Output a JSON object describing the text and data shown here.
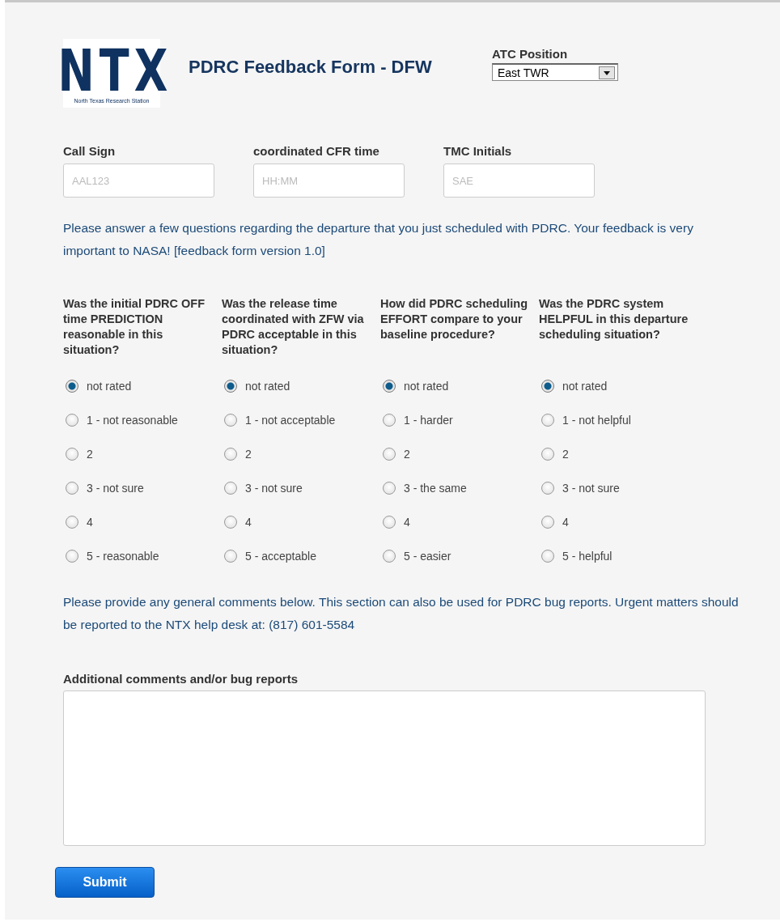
{
  "logo": {
    "letters": "NTX",
    "caption": "North Texas Research Station"
  },
  "title": "PDRC Feedback Form - DFW",
  "atc_position": {
    "label": "ATC Position",
    "value": "East TWR"
  },
  "fields": [
    {
      "label": "Call Sign",
      "placeholder": "AAL123"
    },
    {
      "label": "coordinated CFR time",
      "placeholder": "HH:MM"
    },
    {
      "label": "TMC Initials",
      "placeholder": "SAE"
    }
  ],
  "intro": "Please answer a few questions regarding the departure that you just scheduled with PDRC. Your feedback is very important to NASA! [feedback form version 1.0]",
  "questions": [
    {
      "text": "Was the initial PDRC OFF time PREDICTION reasonable in this situation?",
      "options": [
        {
          "label": "not rated",
          "selected": true
        },
        {
          "label": "1 - not reasonable",
          "selected": false
        },
        {
          "label": "2",
          "selected": false
        },
        {
          "label": "3 - not sure",
          "selected": false
        },
        {
          "label": "4",
          "selected": false
        },
        {
          "label": "5 - reasonable",
          "selected": false
        }
      ]
    },
    {
      "text": "Was the release time coordinated with ZFW via PDRC acceptable in this situation?",
      "options": [
        {
          "label": "not rated",
          "selected": true
        },
        {
          "label": "1 - not acceptable",
          "selected": false
        },
        {
          "label": "2",
          "selected": false
        },
        {
          "label": "3 - not sure",
          "selected": false
        },
        {
          "label": "4",
          "selected": false
        },
        {
          "label": "5 - acceptable",
          "selected": false
        }
      ]
    },
    {
      "text": "How did PDRC scheduling EFFORT compare to your baseline procedure?",
      "options": [
        {
          "label": "not rated",
          "selected": true
        },
        {
          "label": "1 - harder",
          "selected": false
        },
        {
          "label": "2",
          "selected": false
        },
        {
          "label": "3 - the same",
          "selected": false
        },
        {
          "label": "4",
          "selected": false
        },
        {
          "label": "5 - easier",
          "selected": false
        }
      ]
    },
    {
      "text": "Was the PDRC system HELPFUL in this departure scheduling situation?",
      "options": [
        {
          "label": "not rated",
          "selected": true
        },
        {
          "label": "1 - not helpful",
          "selected": false
        },
        {
          "label": "2",
          "selected": false
        },
        {
          "label": "3 - not sure",
          "selected": false
        },
        {
          "label": "4",
          "selected": false
        },
        {
          "label": "5 - helpful",
          "selected": false
        }
      ]
    }
  ],
  "comments_note": "Please provide any general comments below. This section can also be used for PDRC bug reports. Urgent matters should be reported to the NTX help desk at: (817) 601-5584",
  "comments": {
    "label": "Additional comments and/or bug reports"
  },
  "submit": "Submit"
}
